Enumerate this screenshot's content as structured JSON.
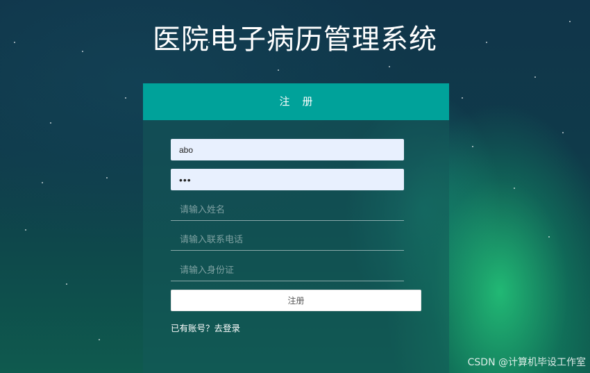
{
  "page": {
    "title": "医院电子病历管理系统"
  },
  "register_panel": {
    "header": "注册",
    "username_value": "abo",
    "password_value": "•••",
    "name_placeholder": "请输入姓名",
    "phone_placeholder": "请输入联系电话",
    "idcard_placeholder": "请输入身份证",
    "submit_label": "注册",
    "login_link": "已有账号？去登录"
  },
  "watermark": {
    "text": "CSDN @计算机毕设工作室"
  },
  "colors": {
    "header_bg": "#00a29a",
    "filled_input_bg": "#e8f0fe"
  }
}
